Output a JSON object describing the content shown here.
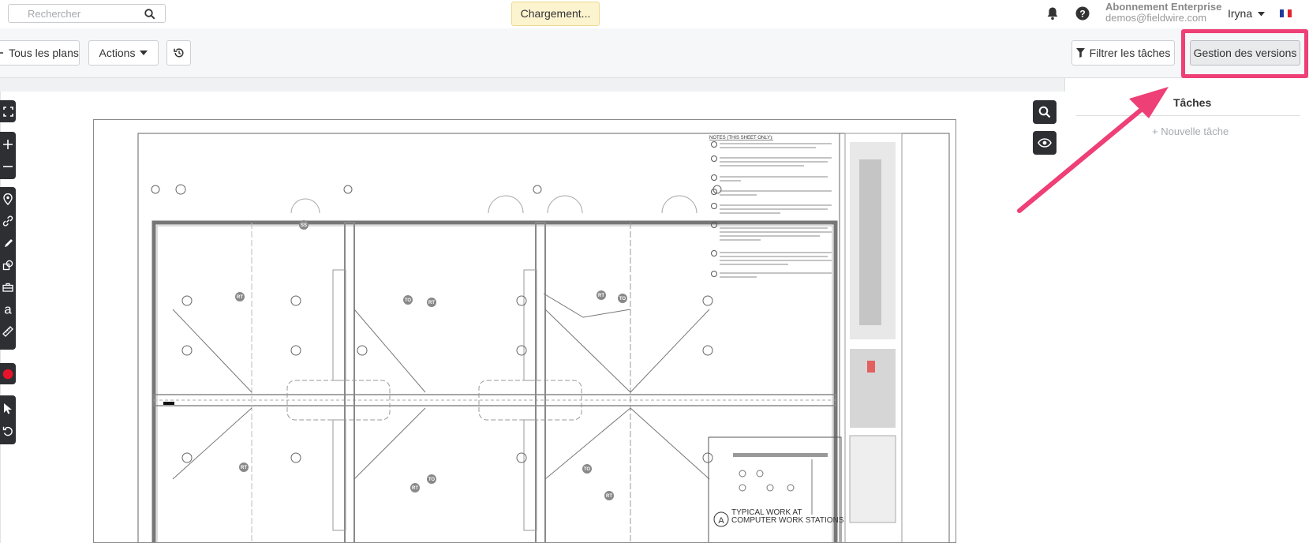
{
  "header": {
    "search_placeholder": "Rechercher",
    "loading_text": "Chargement...",
    "account_plan": "Abonnement Enterprise",
    "account_email": "demos@fieldwire.com",
    "user_name": "Iryna",
    "language_flag": "fr-flag-icon"
  },
  "toolbar": {
    "all_plans_label": "Tous les plans",
    "actions_label": "Actions",
    "filter_tasks_label": "Filtrer les tâches",
    "version_management_label": "Gestion des versions"
  },
  "side_panel": {
    "title": "Tâches",
    "new_task_label": "+ Nouvelle tâche"
  },
  "plan": {
    "notes_title": "NOTES (THIS SHEET ONLY):",
    "detail_letter": "A",
    "detail_title_line1": "TYPICAL WORK AT",
    "detail_title_line2": "COMPUTER WORK STATIONS",
    "badges": [
      "SS",
      "RT",
      "TO",
      "RT",
      "RT",
      "TO",
      "RT",
      "RT",
      "TO",
      "TO",
      "RT"
    ]
  },
  "colors": {
    "highlight": "#ee3f76",
    "loading_bg": "#fcf3cf",
    "tool_dark": "#2d2f33",
    "color_swatch": "#e8122a"
  }
}
